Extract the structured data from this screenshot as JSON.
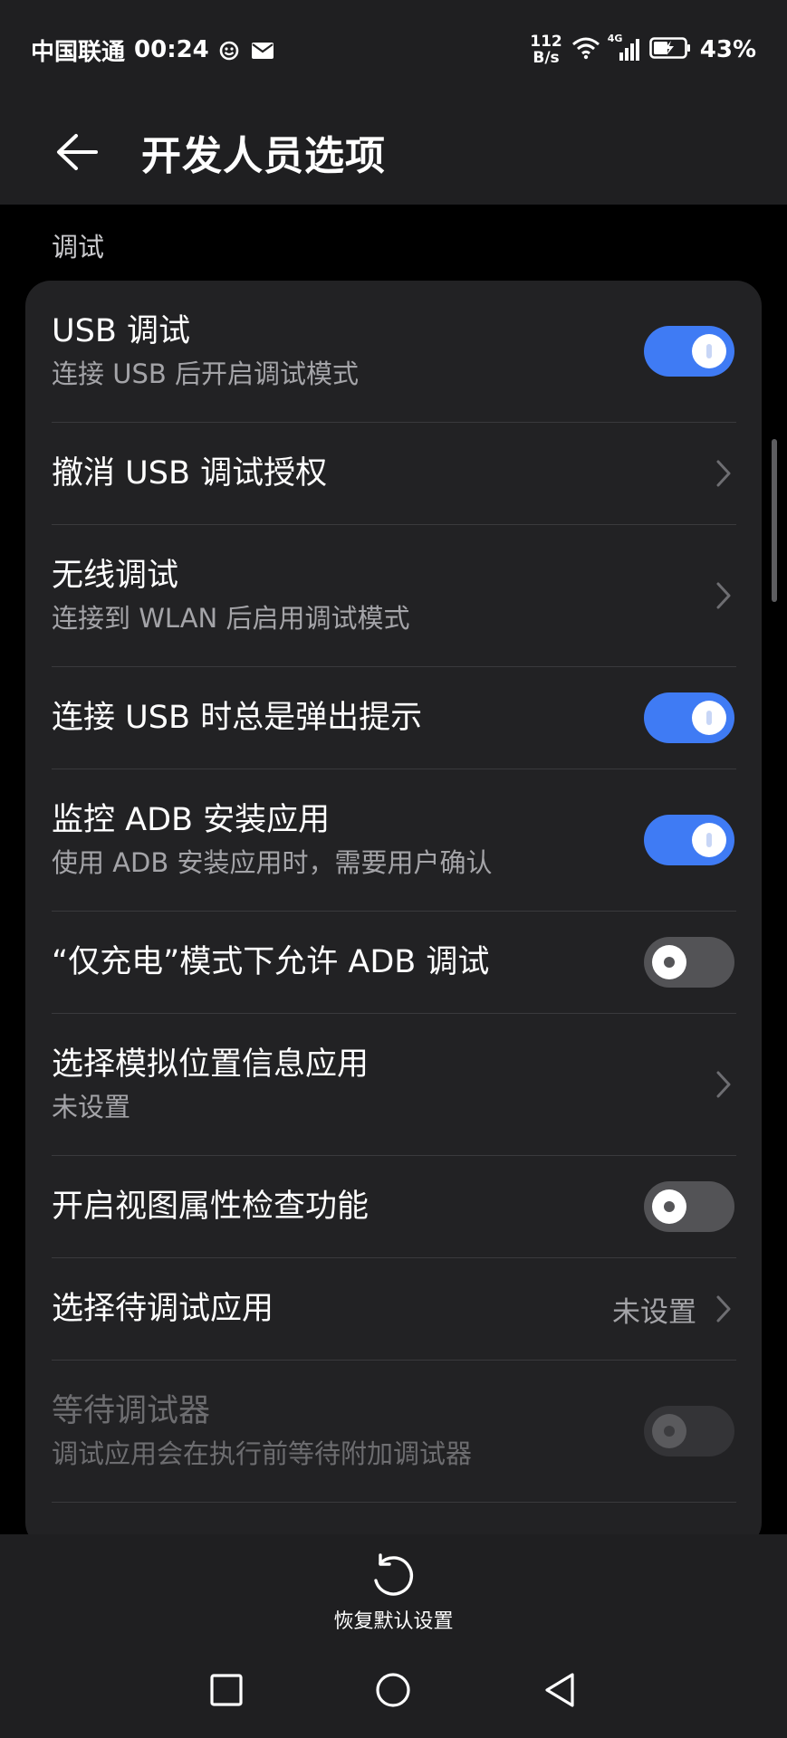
{
  "status_bar": {
    "carrier": "中国联通",
    "time": "00:24",
    "net_speed_value": "112",
    "net_speed_unit": "B/s",
    "network_type": "4G",
    "battery": "43%"
  },
  "header": {
    "title": "开发人员选项"
  },
  "section": {
    "label": "调试"
  },
  "rows": [
    {
      "title": "USB 调试",
      "subtitle": "连接 USB 后开启调试模式",
      "control": "toggle",
      "state": "on"
    },
    {
      "title": "撤消 USB 调试授权",
      "control": "chevron"
    },
    {
      "title": "无线调试",
      "subtitle": "连接到 WLAN 后启用调试模式",
      "control": "chevron"
    },
    {
      "title": "连接 USB 时总是弹出提示",
      "control": "toggle",
      "state": "on"
    },
    {
      "title": "监控 ADB 安装应用",
      "subtitle": "使用 ADB 安装应用时，需要用户确认",
      "control": "toggle",
      "state": "on"
    },
    {
      "title": "“仅充电”模式下允许 ADB 调试",
      "control": "toggle",
      "state": "off"
    },
    {
      "title": "选择模拟位置信息应用",
      "subtitle": "未设置",
      "control": "chevron"
    },
    {
      "title": "开启视图属性检查功能",
      "control": "toggle",
      "state": "off"
    },
    {
      "title": "选择待调试应用",
      "value": "未设置",
      "control": "chevron"
    },
    {
      "title": "等待调试器",
      "subtitle": "调试应用会在执行前等待附加调试器",
      "control": "toggle",
      "state": "off",
      "disabled": true
    }
  ],
  "bottom_bar": {
    "reset_label": "恢复默认设置"
  },
  "colors": {
    "accent": "#3f7bf4",
    "card_bg": "#222224",
    "header_bg": "#1f1f21",
    "secondary_text": "#a4a4a8"
  }
}
